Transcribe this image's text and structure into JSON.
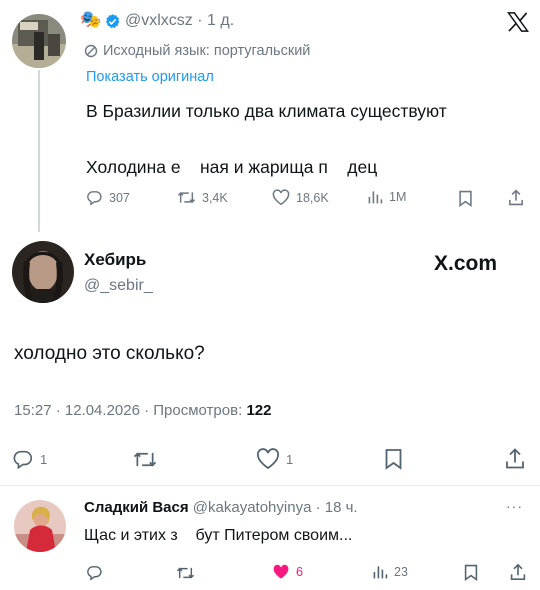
{
  "tweet1": {
    "handle": "@vxlxcsz",
    "separator": "·",
    "time": "1 д.",
    "source_lang": "Исходный язык: португальский",
    "show_original": "Показать оригинал",
    "line1": "В Бразилии только два климата существуют",
    "line2": "Холодина е    ная и жарища п    дец",
    "replies": "307",
    "retweets": "3,4K",
    "likes": "18,6K",
    "views": "1M"
  },
  "tweet2": {
    "name": "Хебирь",
    "handle": "@_sebir_",
    "watermark": "X.com",
    "text": "холодно это сколько?",
    "timestamp": "15:27 · 12.04.2026 · Просмотров:",
    "views": "122",
    "replies": "1",
    "likes": "1"
  },
  "tweet3": {
    "name": "Сладкий Вася",
    "handle": "@kakayatohyinya",
    "separator": "·",
    "time": "18 ч.",
    "more": "···",
    "text": "Щас и этих з    бут Питером своим...",
    "likes": "6",
    "views": "23"
  },
  "colors": {
    "accent": "#1d9bf0",
    "like": "#f91880",
    "muted": "#6b7782"
  }
}
